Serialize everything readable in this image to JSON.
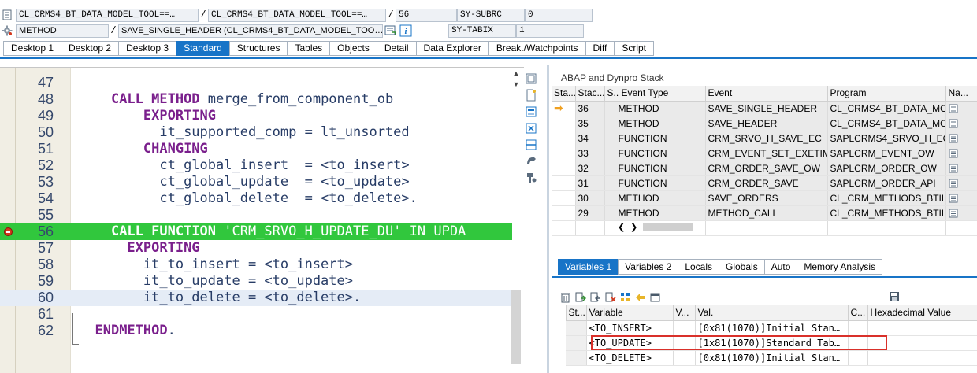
{
  "header": {
    "row1": {
      "program": "CL_CRMS4_BT_DATA_MODEL_TOOL==…",
      "include": "CL_CRMS4_BT_DATA_MODEL_TOOL==…",
      "line": "56",
      "sysvar_name": "SY-SUBRC",
      "sysvar_value": "0"
    },
    "row2": {
      "event_type": "METHOD",
      "event_name": "SAVE_SINGLE_HEADER (CL_CRMS4_BT_DATA_MODEL_TOO…",
      "sysvar_name": "SY-TABIX",
      "sysvar_value": "1"
    },
    "separators": {
      "slash": "/"
    }
  },
  "tabs": [
    "Desktop 1",
    "Desktop 2",
    "Desktop 3",
    "Standard",
    "Structures",
    "Tables",
    "Objects",
    "Detail",
    "Data Explorer",
    "Break./Watchpoints",
    "Diff",
    "Script"
  ],
  "active_tab": "Standard",
  "editor": {
    "lines": [
      {
        "num": "47",
        "text": ""
      },
      {
        "num": "48",
        "kw": "CALL METHOD",
        "text": " merge_from_component_ob",
        "indent": "    "
      },
      {
        "num": "49",
        "kw": "EXPORTING",
        "text": "",
        "indent": "        "
      },
      {
        "num": "50",
        "text": "it_supported_comp = lt_unsorted",
        "indent": "          "
      },
      {
        "num": "51",
        "kw": "CHANGING",
        "text": "",
        "indent": "        "
      },
      {
        "num": "52",
        "text": "ct_global_insert  = <to_insert>",
        "indent": "          "
      },
      {
        "num": "53",
        "text": "ct_global_update  = <to_update>",
        "indent": "          "
      },
      {
        "num": "54",
        "text": "ct_global_delete  = <to_delete>.",
        "indent": "          "
      },
      {
        "num": "55",
        "text": ""
      },
      {
        "num": "56",
        "kw": "CALL FUNCTION",
        "text": " 'CRM_SRVO_H_UPDATE_DU' IN UPDA",
        "indent": "    "
      },
      {
        "num": "57",
        "kw": "EXPORTING",
        "text": "",
        "indent": "      "
      },
      {
        "num": "58",
        "text": "it_to_insert = <to_insert>",
        "indent": "        "
      },
      {
        "num": "59",
        "text": "it_to_update = <to_update>",
        "indent": "        "
      },
      {
        "num": "60",
        "text": "it_to_delete = <to_delete>.",
        "indent": "        "
      },
      {
        "num": "61",
        "text": ""
      },
      {
        "num": "62",
        "kw": "ENDMETHOD",
        "text": ".",
        "indent": "  "
      }
    ]
  },
  "stack": {
    "title": "ABAP and Dynpro Stack",
    "columns": [
      "Sta...",
      "Stac...",
      "S...",
      "Event Type",
      "Event",
      "Program",
      "Na..."
    ],
    "rows": [
      {
        "level": "36",
        "type": "METHOD",
        "event": "SAVE_SINGLE_HEADER",
        "program": "CL_CRMS4_BT_DATA_MO…",
        "current": true
      },
      {
        "level": "35",
        "type": "METHOD",
        "event": "SAVE_HEADER",
        "program": "CL_CRMS4_BT_DATA_MO…"
      },
      {
        "level": "34",
        "type": "FUNCTION",
        "event": "CRM_SRVO_H_SAVE_EC",
        "program": "SAPLCRMS4_SRVO_H_EC"
      },
      {
        "level": "33",
        "type": "FUNCTION",
        "event": "CRM_EVENT_SET_EXETIM…",
        "program": "SAPLCRM_EVENT_OW"
      },
      {
        "level": "32",
        "type": "FUNCTION",
        "event": "CRM_ORDER_SAVE_OW",
        "program": "SAPLCRM_ORDER_OW"
      },
      {
        "level": "31",
        "type": "FUNCTION",
        "event": "CRM_ORDER_SAVE",
        "program": "SAPLCRM_ORDER_API"
      },
      {
        "level": "30",
        "type": "METHOD",
        "event": "SAVE_ORDERS",
        "program": "CL_CRM_METHODS_BTIL=…"
      },
      {
        "level": "29",
        "type": "METHOD",
        "event": "METHOD_CALL",
        "program": "CL_CRM_METHODS_BTIL=…"
      }
    ]
  },
  "variables": {
    "tabs": [
      "Variables 1",
      "Variables 2",
      "Locals",
      "Globals",
      "Auto",
      "Memory Analysis"
    ],
    "active_tab": "Variables 1",
    "columns": [
      "St...",
      "Variable",
      "V...",
      "Val.",
      "C...",
      "Hexadecimal Value"
    ],
    "rows": [
      {
        "name": "<TO_INSERT>",
        "value": "[0x81(1070)]Initial Stan…"
      },
      {
        "name": "<TO_UPDATE>",
        "value": "[1x81(1070)]Standard Tab…",
        "highlighted": true
      },
      {
        "name": "<TO_DELETE>",
        "value": "[0x81(1070)]Initial Stan…"
      }
    ]
  },
  "colors": {
    "accent": "#1874c7",
    "exec_line": "#31c73d",
    "keyword": "#7a1f8c",
    "highlight_box": "#d9302a"
  }
}
